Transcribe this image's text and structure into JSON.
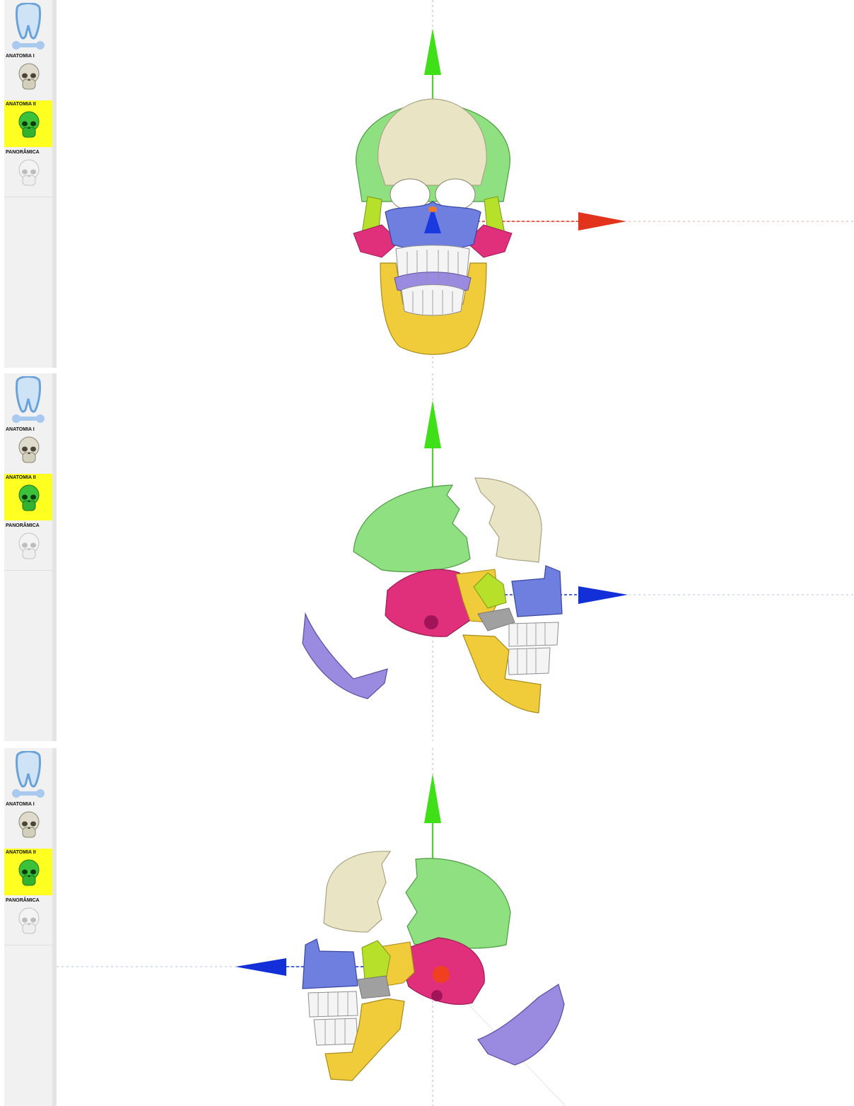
{
  "panels": [
    {
      "view": "front",
      "sidebar": {
        "items": [
          {
            "label": "ANATOMIA I",
            "icon": "skull-natural-icon",
            "active": false
          },
          {
            "label": "ANATOMIA II",
            "icon": "skull-colored-icon",
            "active": true
          },
          {
            "label": "PANORÂMICA",
            "icon": "skull-white-icon",
            "active": false
          }
        ]
      },
      "gizmo": {
        "up_axis_color": "#3fe018",
        "horizontal_axis_color": "#e2331c"
      }
    },
    {
      "view": "side-exploded-right",
      "sidebar": {
        "items": [
          {
            "label": "ANATOMIA I",
            "icon": "skull-natural-icon",
            "active": false
          },
          {
            "label": "ANATOMIA II",
            "icon": "skull-colored-icon",
            "active": true
          },
          {
            "label": "PANORÂMICA",
            "icon": "skull-white-icon",
            "active": false
          }
        ]
      },
      "gizmo": {
        "up_axis_color": "#3fe018",
        "horizontal_axis_color": "#1330d8"
      }
    },
    {
      "view": "side-exploded-left",
      "sidebar": {
        "items": [
          {
            "label": "ANATOMIA I",
            "icon": "skull-natural-icon",
            "active": false
          },
          {
            "label": "ANATOMIA II",
            "icon": "skull-colored-icon",
            "active": true
          },
          {
            "label": "PANORÂMICA",
            "icon": "skull-white-icon",
            "active": false
          }
        ]
      },
      "gizmo": {
        "up_axis_color": "#3fe018",
        "horizontal_axis_color": "#1330d8"
      }
    }
  ],
  "colors": {
    "active_menu": "#ffff22",
    "frontal_bone": "#e9e5c4",
    "parietal_bone": "#8ee080",
    "maxilla": "#6f7fe0",
    "zygomatic": "#b6e02a",
    "temporal": "#e0307c",
    "mandible": "#f0cc3a",
    "palatine": "#9a8ae0",
    "teeth": "#f4f4f4"
  }
}
